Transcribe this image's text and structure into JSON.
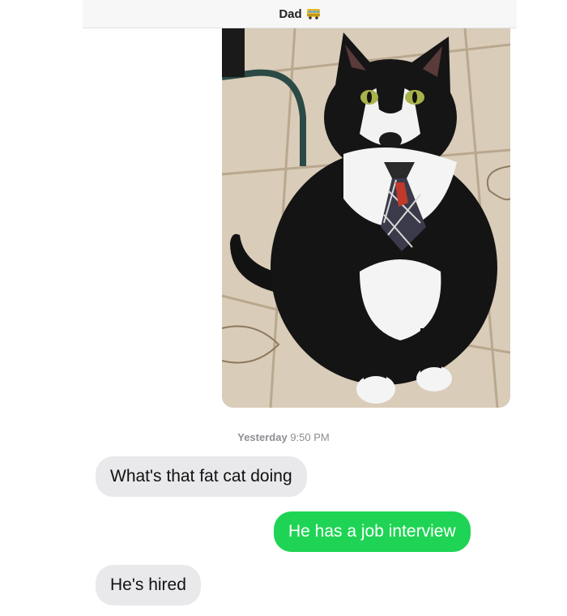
{
  "header": {
    "contact_name": "Dad",
    "contact_emoji_icon": "bus-icon"
  },
  "conversation": {
    "photo": {
      "description_icon": "cat-photo"
    },
    "timestamp": {
      "day": "Yesterday",
      "time": "9:50 PM"
    },
    "messages": [
      {
        "side": "received",
        "text": "What's that fat cat doing"
      },
      {
        "side": "sent",
        "text": "He has a job interview"
      },
      {
        "side": "received",
        "text": "He's hired"
      }
    ]
  },
  "colors": {
    "sent_bubble": "#1fd454",
    "received_bubble": "#e9e9eb",
    "timestamp": "#8e8e93"
  }
}
